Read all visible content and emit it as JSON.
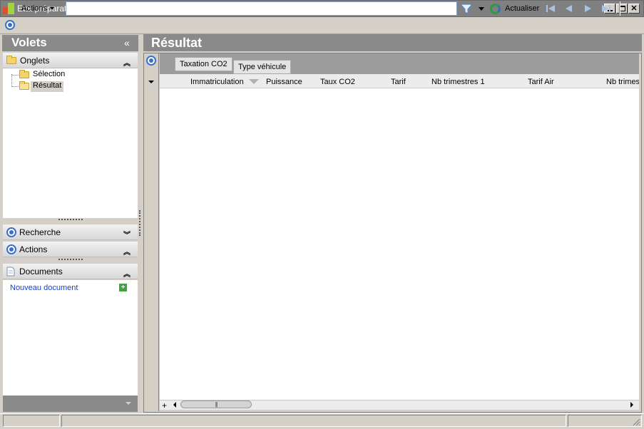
{
  "window": {
    "title": "Etat préparatoire",
    "buttons": {
      "minimize": "_",
      "maximize": "□",
      "close": "✕"
    }
  },
  "toolbar": {
    "actions_label": "Actions",
    "search": {
      "value": "",
      "placeholder": ""
    },
    "refresh_label": "Actualiser"
  },
  "left_pane": {
    "title": "Volets",
    "collapse_glyph": "«",
    "onglets": {
      "label": "Onglets",
      "items": [
        {
          "label": "Sélection",
          "selected": false
        },
        {
          "label": "Résultat",
          "selected": true
        }
      ]
    },
    "recherche": {
      "label": "Recherche"
    },
    "actions": {
      "label": "Actions"
    },
    "documents": {
      "label": "Documents",
      "new_document": "Nouveau document"
    },
    "chevrons": {
      "expanded": "︽",
      "collapsed": "︾"
    }
  },
  "main": {
    "title": "Résultat",
    "group_tabs": [
      "Taxation CO2",
      "Type véhicule"
    ],
    "columns": [
      "Immatriculation",
      "Puissance",
      "Taux CO2",
      "Tarif",
      "Nb trimestres 1",
      "Tarif Air",
      "Nb trimes"
    ],
    "rows": [],
    "scroll_plus": "+",
    "scroll_thumb_grip": "|||"
  },
  "colors": {
    "header_gray": "#8a8a8a",
    "accent_blue": "#3c6fc8",
    "link_blue": "#1a3dc8",
    "folder_yellow": "#f4d36b"
  },
  "icons": [
    "app-icon",
    "circle-menu-icon",
    "filter-icon",
    "refresh-icon",
    "first-icon",
    "prev-icon",
    "next-icon",
    "last-icon",
    "folder-icon",
    "document-icon",
    "plus-icon"
  ]
}
